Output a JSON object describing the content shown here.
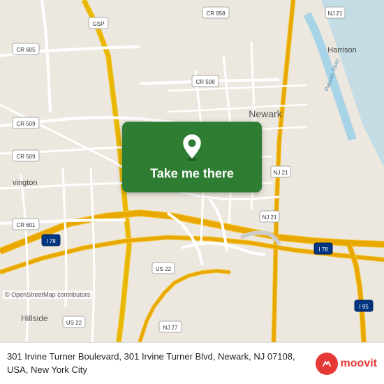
{
  "map": {
    "background_color": "#e8e0d8",
    "center_lat": 40.724,
    "center_lng": -74.172
  },
  "button": {
    "label": "Take me there",
    "background_color": "#2e7d32"
  },
  "attribution": {
    "text": "© OpenStreetMap contributors"
  },
  "address": {
    "full": "301 Irvine Turner Boulevard, 301 Irvine Turner Blvd, Newark, NJ 07108, USA, New York City"
  },
  "branding": {
    "logo_text": "moovit",
    "logo_color": "#e53935"
  },
  "road_labels": [
    "CR 605",
    "GSP",
    "CR 658",
    "NJ 21",
    "Harrison",
    "CR 509",
    "CR 508",
    "Passaic River",
    "CR 509",
    "Newark",
    "vington",
    "NJ 21",
    "CR 601",
    "NJ 21",
    "I 78",
    "I 78",
    "US 22",
    "NJ 27",
    "I 95",
    "Hillside",
    "US 22"
  ]
}
